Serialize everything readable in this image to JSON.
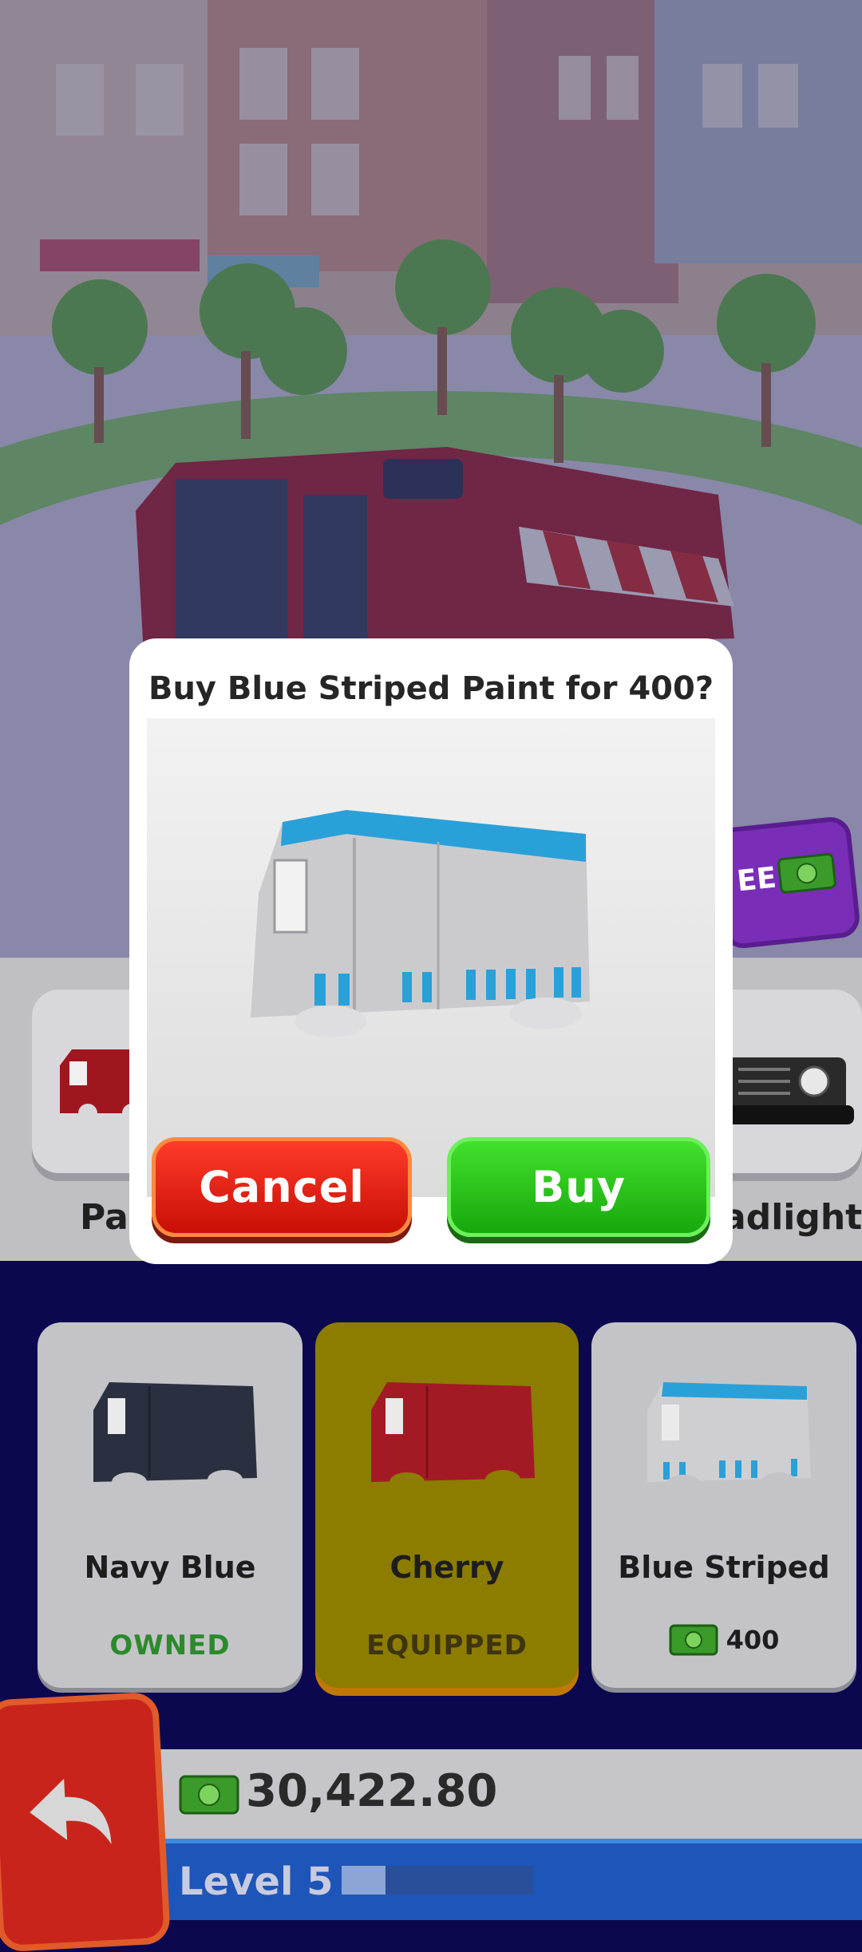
{
  "modal": {
    "title": "Buy Blue Striped Paint for 400?",
    "cancel_label": "Cancel",
    "buy_label": "Buy"
  },
  "categories": [
    {
      "label": "Pai"
    },
    {
      "label": "adlights"
    }
  ],
  "side_button": {
    "label": "EE"
  },
  "items": [
    {
      "name": "Navy Blue",
      "status": "OWNED",
      "status_color": "#2c8a2c",
      "body_color": "#2b3040"
    },
    {
      "name": "Cherry",
      "status": "EQUIPPED",
      "status_color": "#3e3410",
      "body_color": "#a31a25"
    },
    {
      "name": "Blue Striped",
      "price": "400",
      "body_color": "#cfcfd2",
      "stripe_color": "#2aa0d8"
    }
  ],
  "wallet": {
    "money": "30,422.80"
  },
  "level": {
    "label": "Level 5",
    "progress": 0.23
  }
}
